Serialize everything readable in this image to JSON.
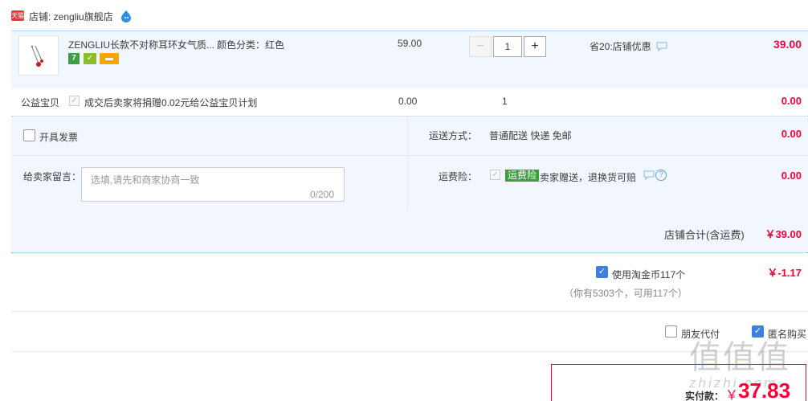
{
  "shop": {
    "badge": "天猫",
    "label": "店铺: zengliu旗舰店",
    "icon": "wangwang-icon"
  },
  "item": {
    "title": "ZENGLIU长款不对称耳环女气质...",
    "spec": "颜色分类：红色",
    "service_badges": [
      "7",
      "✓",
      "▬"
    ],
    "unit_price": "59.00",
    "quantity": "1",
    "qty_minus": "−",
    "qty_plus": "+",
    "discount": "省20:店铺优惠",
    "subtotal": "39.00"
  },
  "charity": {
    "label": "公益宝贝",
    "text": "成交后卖家将捐赠0.02元给公益宝贝计划",
    "price": "0.00",
    "qty": "1",
    "total": "0.00"
  },
  "invoice": {
    "label": "开具发票"
  },
  "shipping": {
    "label": "运送方式：",
    "value": "普通配送 快递 免邮",
    "fee": "0.00"
  },
  "memo": {
    "label": "给卖家留言：",
    "placeholder": "选填,请先和商家协商一致",
    "count": "0/200"
  },
  "insurance": {
    "label": "运费险：",
    "badge": "运费险",
    "text": "卖家赠送，退换货可赔",
    "fee": "0.00"
  },
  "store_total": {
    "label": "店铺合计(含运费)",
    "value": "￥39.00"
  },
  "coins": {
    "label": "使用淘金币117个",
    "value": "￥-1.17",
    "note": "（你有5303个，可用117个）",
    "checked": true
  },
  "options": {
    "friend_pay": "朋友代付",
    "anonymous": "匿名购买",
    "anonymous_checked": true
  },
  "payment": {
    "label": "实付款：",
    "currency": "￥",
    "value": "37.83"
  },
  "watermark": {
    "logo": "值值值",
    "text": "zhizhi.com"
  },
  "colors": {
    "accent_red": "#ff0036",
    "row_bg": "#f2f7ff",
    "checkbox_blue": "#3d7fe3",
    "insurance_green": "#36a337"
  }
}
